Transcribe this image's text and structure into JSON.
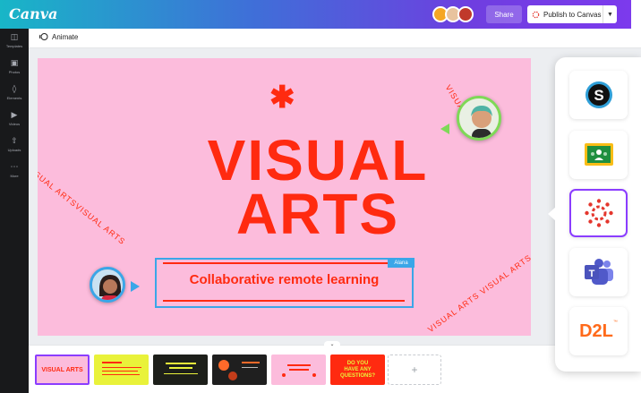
{
  "app": {
    "logo": "Canva"
  },
  "topbar": {
    "share_label": "Share",
    "publish_label": "Publish to Canvas",
    "chevron_icon": "chevron-down-icon",
    "gradient_colors": [
      "#18b6c7",
      "#3f6fd8",
      "#7c3aed"
    ]
  },
  "sidebar": {
    "items": [
      {
        "label": "Templates",
        "icon": "templates-icon"
      },
      {
        "label": "Photos",
        "icon": "photos-icon"
      },
      {
        "label": "Elements",
        "icon": "elements-icon"
      },
      {
        "label": "Videos",
        "icon": "videos-icon"
      },
      {
        "label": "Uploads",
        "icon": "uploads-icon"
      },
      {
        "label": "More",
        "icon": "more-icon"
      }
    ]
  },
  "toolbar": {
    "animate_label": "Animate"
  },
  "slide": {
    "title_line1": "VISUAL",
    "title_line2": "ARTS",
    "subtitle": "Collaborative remote learning",
    "collaborator_tag": "Alana",
    "curved_text_left": "VISUAL ARTSVISUAL ARTS",
    "curved_text_right_top": "VISUAL ARTS",
    "curved_text_right_bottom": "VISUAL ARTS VISUAL ARTS",
    "background_color": "#fcbcdc",
    "accent_color": "#ff2a10"
  },
  "filmstrip": {
    "thumbnails": [
      {
        "text": "VISUAL ARTS",
        "bg": "#fcbcdc",
        "fg": "#ff2a10"
      },
      {
        "text": "",
        "bg": "#e9f23a",
        "fg": "#ff2a10"
      },
      {
        "text": "",
        "bg": "#1d1f1a",
        "fg": "#e9f23a"
      },
      {
        "text": "",
        "bg": "#1f1f1f",
        "fg": "#ff6a2a"
      },
      {
        "text": "",
        "bg": "#fcbcdc",
        "fg": "#ff2a10"
      },
      {
        "text": "DO YOU HAVE ANY QUESTIONS?",
        "bg": "#ff2a10",
        "fg": "#e9f23a"
      }
    ],
    "add_label": "+"
  },
  "integrations": [
    {
      "name": "Schoology",
      "icon": "schoology-icon"
    },
    {
      "name": "Google Classroom",
      "icon": "google-classroom-icon"
    },
    {
      "name": "Canvas",
      "icon": "canvas-lms-icon"
    },
    {
      "name": "Microsoft Teams",
      "icon": "teams-icon"
    },
    {
      "name": "D2L",
      "label": "D2L",
      "icon": "d2l-icon"
    }
  ]
}
